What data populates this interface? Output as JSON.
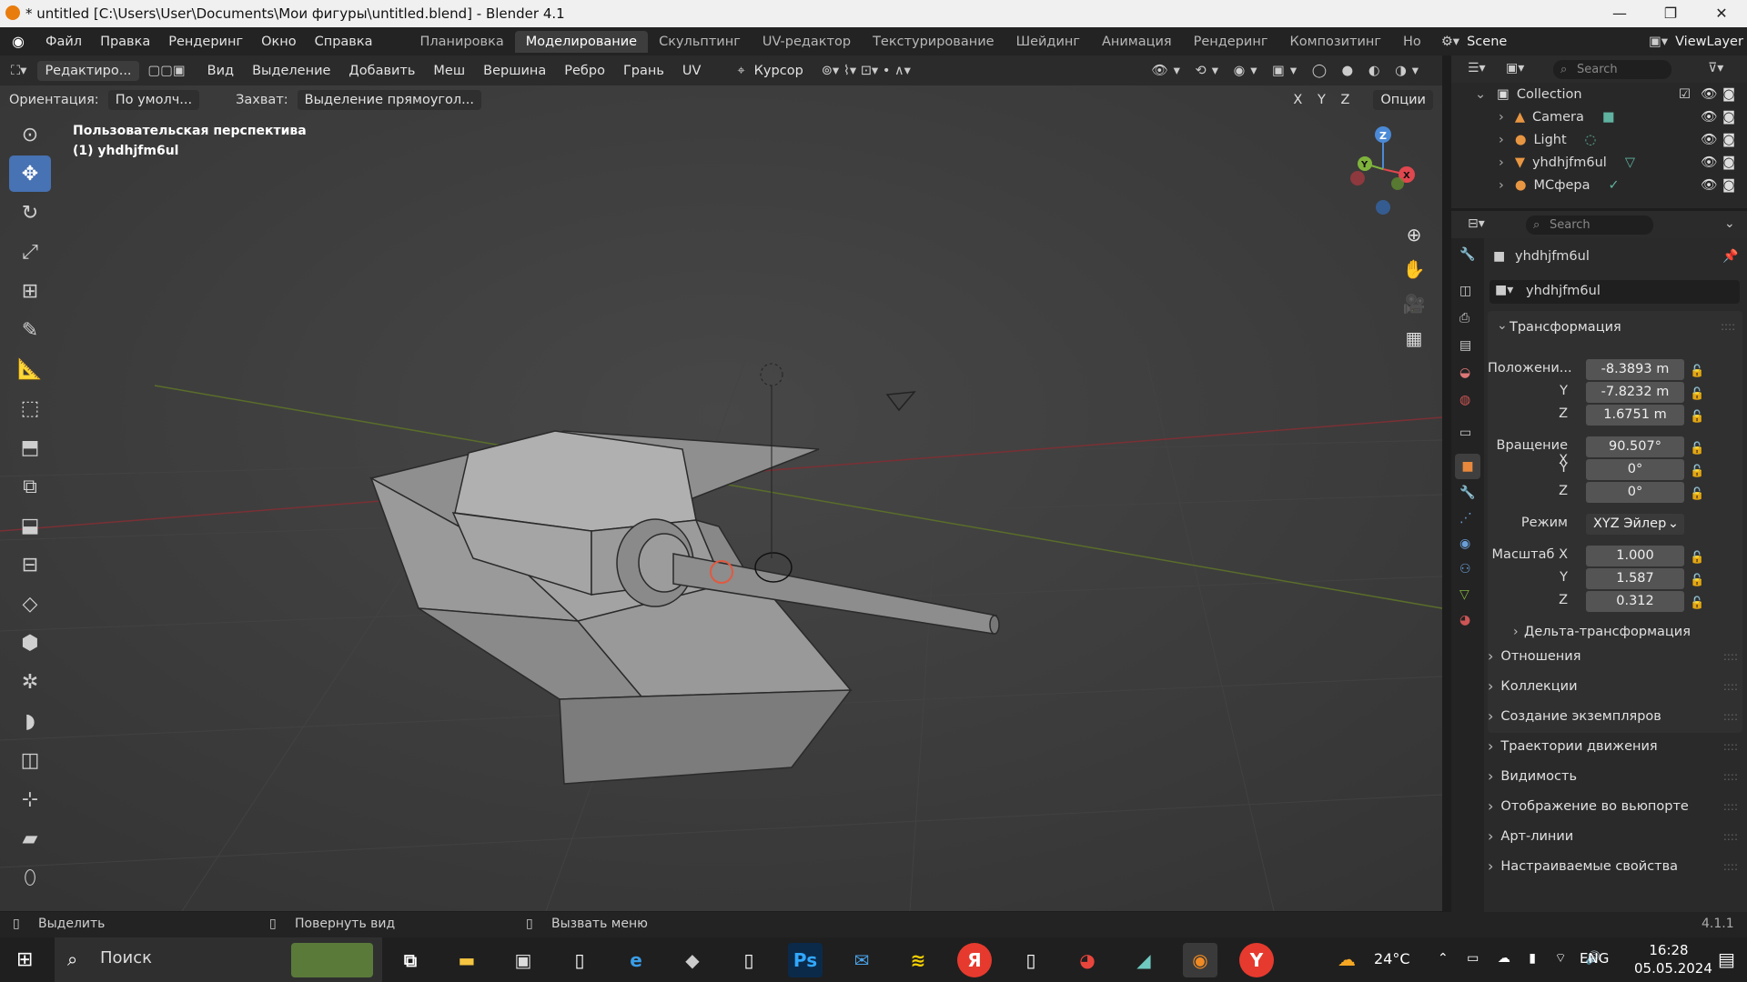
{
  "titlebar": {
    "title": "* untitled [C:\\Users\\User\\Documents\\Мои фигуры\\untitled.blend] - Blender 4.1"
  },
  "menus": [
    "Файл",
    "Правка",
    "Рендеринг",
    "Окно",
    "Справка"
  ],
  "workspaces": [
    "Планировка",
    "Моделирование",
    "Скульптинг",
    "UV-редактор",
    "Текстурирование",
    "Шейдинг",
    "Анимация",
    "Рендеринг",
    "Композитинг",
    "Но"
  ],
  "active_workspace": "Моделирование",
  "scene": "Scene",
  "view_layer": "ViewLayer",
  "header": {
    "mode": "Редактиро...",
    "menus": [
      "Вид",
      "Выделение",
      "Добавить",
      "Меш",
      "Вершина",
      "Ребро",
      "Грань",
      "UV"
    ],
    "cursor": "Курсор",
    "orientation_label": "Ориентация:",
    "orientation_value": "По умолч...",
    "snap_label": "Захват:",
    "snap_value": "Выделение прямоугол...",
    "axes": [
      "X",
      "Y",
      "Z"
    ],
    "options": "Опции"
  },
  "viewport": {
    "view_name": "Пользовательская перспектива",
    "object_name": "(1) yhdhjfm6ul",
    "gizmo_axes": [
      "Z",
      "Y",
      "X"
    ]
  },
  "outliner": {
    "search_placeholder": "Search",
    "collection": "Collection",
    "items": [
      "Camera",
      "Light",
      "yhdhjfm6ul",
      "МСфера"
    ]
  },
  "properties": {
    "search_placeholder": "Search",
    "object_name": "yhdhjfm6ul",
    "data_name": "yhdhjfm6ul",
    "transform_title": "Трансформация",
    "location_label": "Положени...",
    "location": [
      "-8.3893 m",
      "-7.8232 m",
      "1.6751 m"
    ],
    "rotation_label": "Вращение X",
    "rotation": [
      "90.507°",
      "0°",
      "0°"
    ],
    "mode_label": "Режим",
    "mode_value": "XYZ Эйлер",
    "scale_label": "Масштаб X",
    "scale": [
      "1.000",
      "1.587",
      "0.312"
    ],
    "axis_y": "Y",
    "axis_z": "Z",
    "delta": "Дельта-трансформация",
    "sections": [
      "Отношения",
      "Коллекции",
      "Создание экземпляров",
      "Траектории движения",
      "Видимость",
      "Отображение во вьюпорте",
      "Арт-линии",
      "Настраиваемые свойства"
    ]
  },
  "statusbar": {
    "select": "Выделить",
    "rotate": "Повернуть вид",
    "menu": "Вызвать меню",
    "version": "4.1.1"
  },
  "taskbar": {
    "search": "Поиск",
    "weather": "24°C",
    "lang": "ENG",
    "time": "16:28",
    "date": "05.05.2024"
  },
  "colors": {
    "accent": "#4772b3",
    "x_axis": "#e0474e",
    "y_axis": "#7fb33c",
    "z_axis": "#4b8ad6"
  }
}
